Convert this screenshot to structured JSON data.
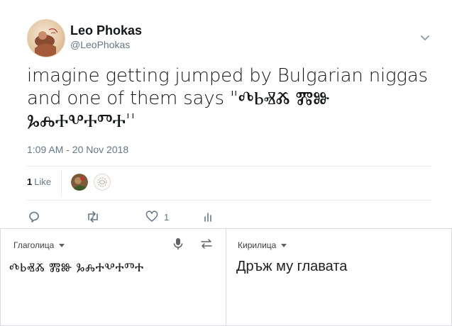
{
  "tweet": {
    "author_name": "Leo Phokas",
    "author_handle": "@LeoPhokas",
    "text": "imagine getting jumped by Bulgarian niggas and one of them says \"ⰄⰓⰟⰆ ⰏⰖ ⰃⰎⰀⰂⰀⰕⰀ''",
    "timestamp": "1:09 AM - 20 Nov 2018",
    "likes_count": "1",
    "likes_label": "Like",
    "actions": {
      "reply_count": "",
      "retweet_count": "",
      "like_count": "1",
      "analytics_count": ""
    }
  },
  "translator": {
    "source_language": "Глаголица",
    "target_language": "Кирилица",
    "source_text": "ⰄⰓⰟⰆ ⰏⰖ ⰃⰎⰀⰂⰀⰕⰀ",
    "target_text": "Дръж му главата"
  },
  "icons": {
    "menu": "chevron-down-icon",
    "reply": "reply-icon",
    "retweet": "retweet-icon",
    "like": "heart-icon",
    "analytics": "analytics-icon",
    "microphone": "microphone-icon",
    "swap": "swap-icon"
  },
  "colors": {
    "text_primary": "#14171a",
    "text_secondary": "#657786",
    "divider": "#e6ecf0",
    "translator_border": "#dadce0"
  }
}
